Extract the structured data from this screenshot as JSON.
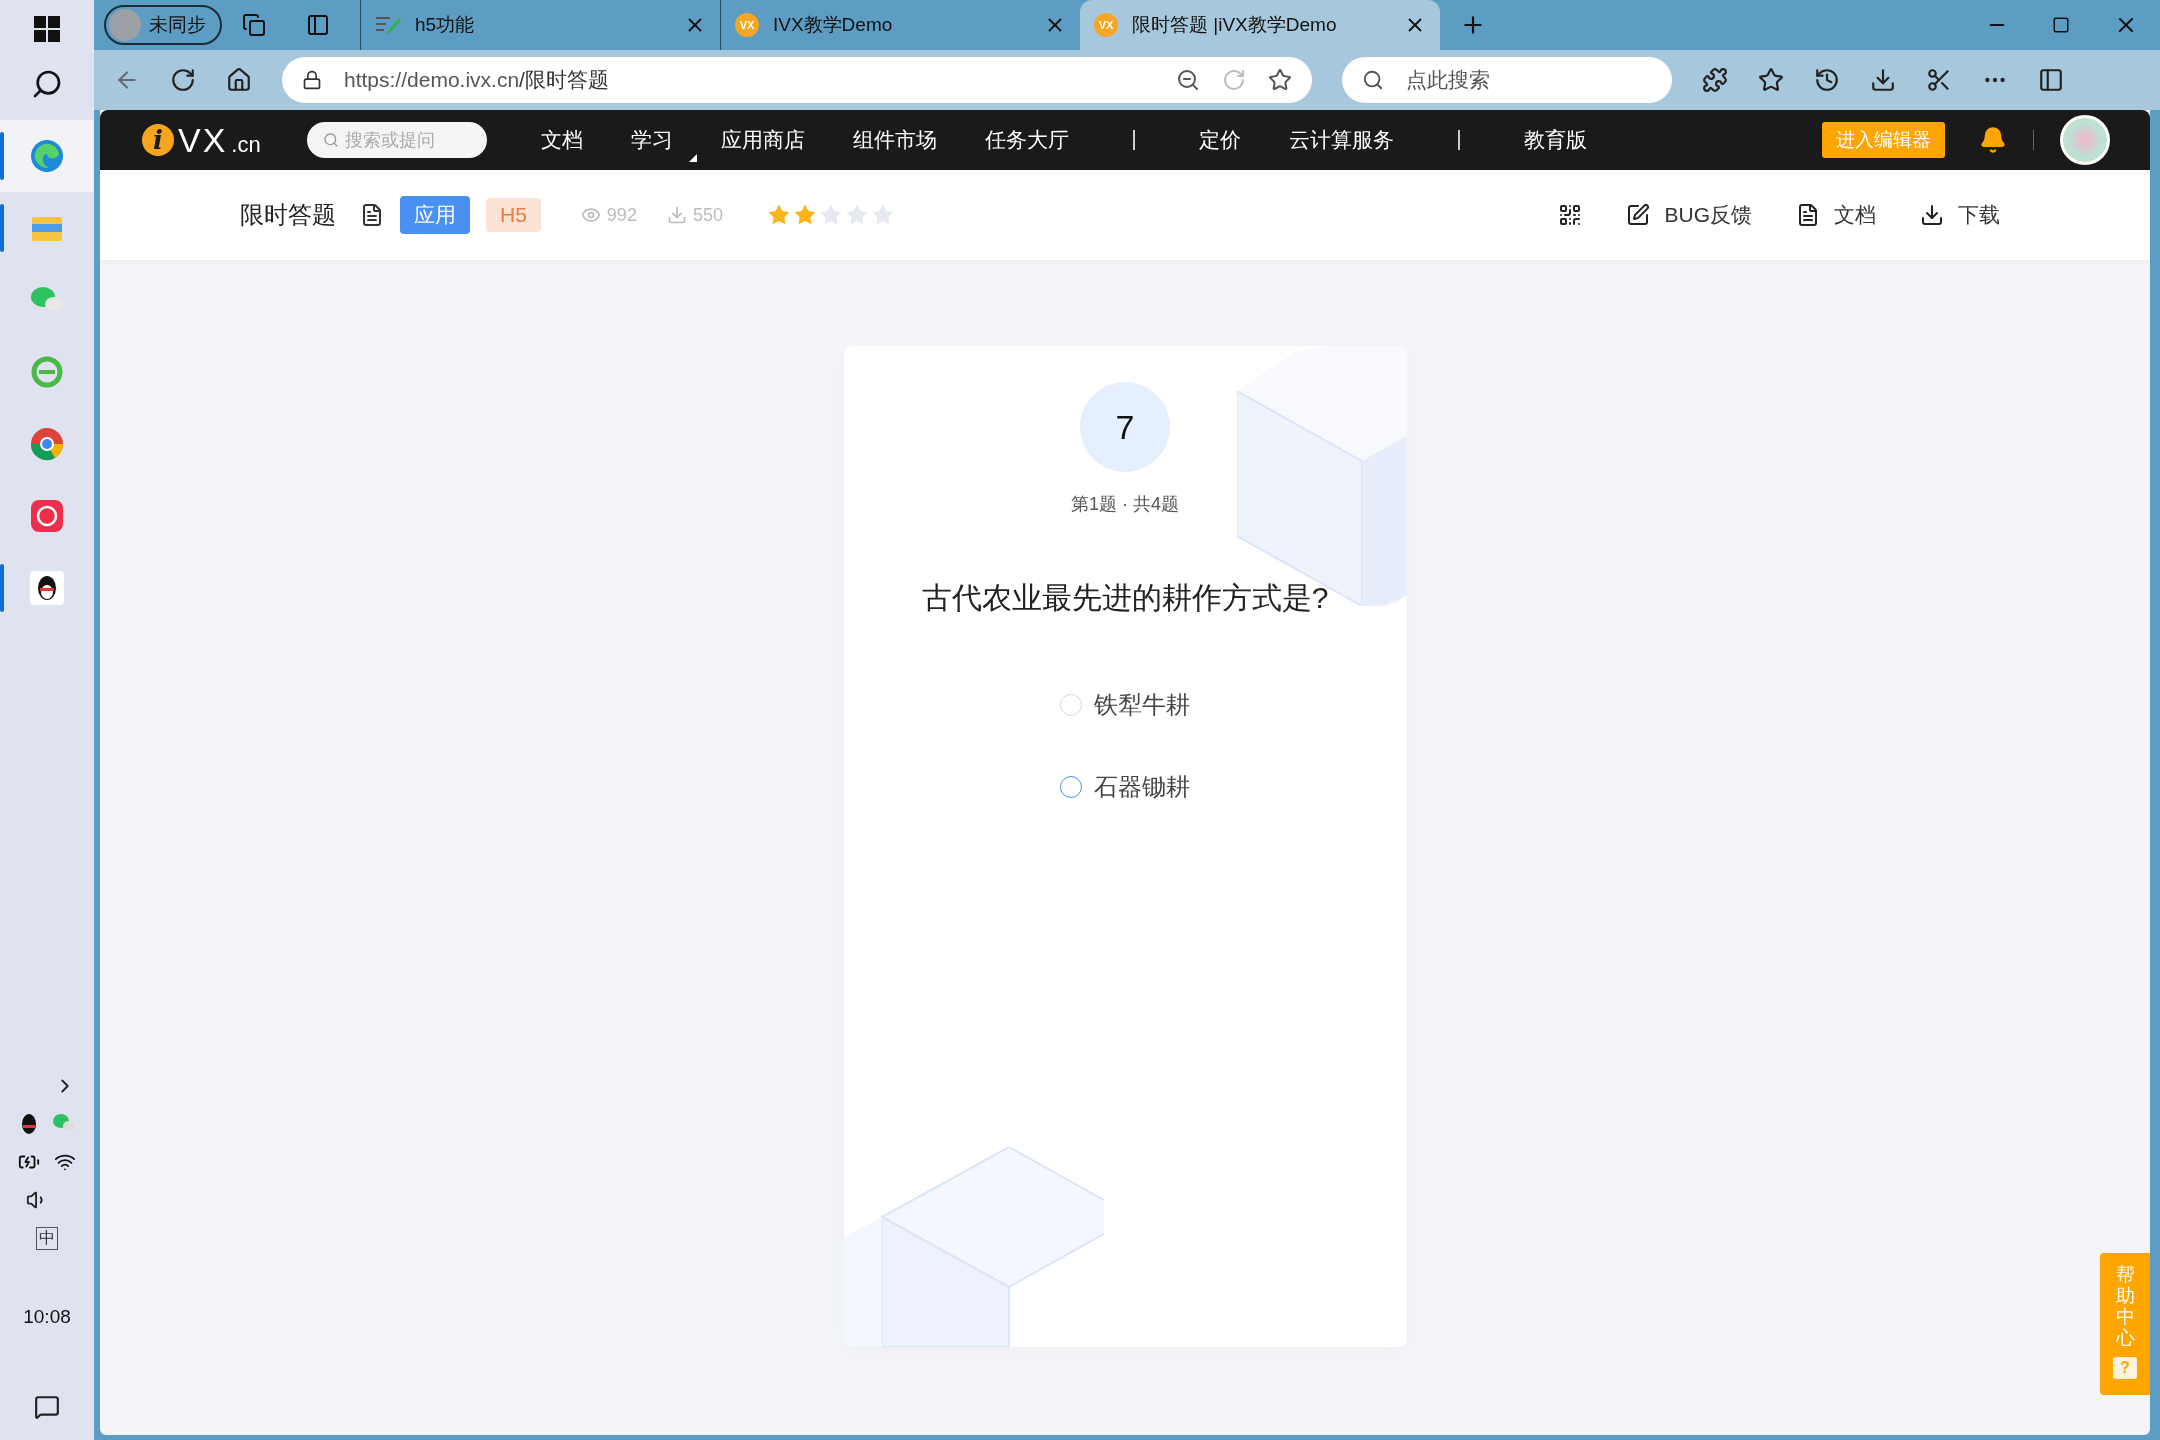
{
  "taskbar": {
    "apps": [
      {
        "kind": "edge",
        "selected": true,
        "running": true
      },
      {
        "kind": "folder",
        "selected": false,
        "running": true
      },
      {
        "kind": "chat",
        "selected": false,
        "running": false
      },
      {
        "kind": "ie",
        "selected": false,
        "running": false
      },
      {
        "kind": "chrome",
        "selected": false,
        "running": false
      },
      {
        "kind": "camera",
        "selected": false,
        "running": false
      },
      {
        "kind": "penguin",
        "selected": false,
        "running": true
      }
    ],
    "input_method": "中",
    "time": "10:08"
  },
  "browser": {
    "profile": "未同步",
    "tabs": [
      {
        "title": "h5功能",
        "selected": false,
        "kind": "pen"
      },
      {
        "title": "IVX教学Demo",
        "selected": false,
        "kind": "vx",
        "favicon": "VX"
      },
      {
        "title": "限时答题 |iVX教学Demo",
        "selected": true,
        "kind": "vx",
        "favicon": "VX"
      }
    ],
    "url_host": "https://demo.ivx.cn",
    "url_path": "/限时答题",
    "search": {
      "placeholder": "点此搜索"
    }
  },
  "site_nav": {
    "logo": {
      "mark": "i",
      "text": "VX",
      "suffix": ".cn"
    },
    "search": {
      "placeholder": "搜索或提问"
    },
    "items": [
      {
        "kind": "link",
        "label": "文档"
      },
      {
        "kind": "dropdown",
        "label": "学习"
      },
      {
        "kind": "link",
        "label": "应用商店"
      },
      {
        "kind": "link",
        "label": "组件市场"
      },
      {
        "kind": "link",
        "label": "任务大厅"
      },
      {
        "kind": "divider"
      },
      {
        "kind": "link",
        "label": "定价"
      },
      {
        "kind": "link",
        "label": "云计算服务"
      },
      {
        "kind": "divider"
      },
      {
        "kind": "link",
        "label": "教育版"
      }
    ],
    "editor_button": "进入编辑器"
  },
  "app_header": {
    "title": "限时答题",
    "tags": [
      {
        "kind": "primary",
        "label": "应用"
      },
      {
        "kind": "secondary",
        "label": "H5"
      }
    ],
    "views": "992",
    "downloads": "550",
    "stars": 2,
    "actions": [
      {
        "kind": "qr"
      },
      {
        "kind": "feedback",
        "label": "BUG反馈"
      },
      {
        "kind": "doc",
        "label": "文档"
      },
      {
        "kind": "download",
        "label": "下载"
      }
    ]
  },
  "quiz": {
    "timer": "7",
    "progress": "第1题 · 共4题",
    "question": "古代农业最先进的耕作方式是?",
    "options": [
      {
        "label": "铁犁牛耕",
        "selected": false,
        "hovered": false
      },
      {
        "label": "石器锄耕",
        "selected": false,
        "hovered": true
      }
    ]
  },
  "help": {
    "label": "帮助中心",
    "icon": "?"
  }
}
